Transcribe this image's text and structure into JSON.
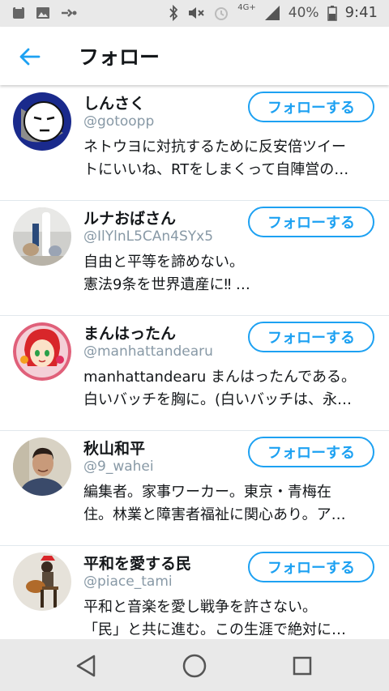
{
  "status_bar": {
    "network": "4G+",
    "battery_percent": "40%",
    "time": "9:41"
  },
  "header": {
    "title": "フォロー"
  },
  "users": [
    {
      "name": "しんさく",
      "handle": "@gotoopp",
      "bio_line1": "ネトウヨに対抗するために反安倍ツイー",
      "bio_line2": "トにいいね、RTをしまくって自陣営の…",
      "follow_label": "フォローする"
    },
    {
      "name": "ルナおばさん",
      "handle": "@IlYlnL5CAn4SYx5",
      "bio_line1": "自由と平等を諦めない。",
      "bio_line2": "憲法9条を世界遺産に‼ …",
      "follow_label": "フォローする"
    },
    {
      "name": "まんはったん",
      "handle": "@manhattandearu",
      "bio_line1": "manhattandearu まんはったんである。",
      "bio_line2": "白いバッチを胸に。(白いバッチは、永…",
      "follow_label": "フォローする"
    },
    {
      "name": "秋山和平",
      "handle": "@9_wahei",
      "bio_line1": "編集者。家事ワーカー。東京・青梅在",
      "bio_line2": "住。林業と障害者福祉に関心あり。ア…",
      "follow_label": "フォローする"
    },
    {
      "name": "平和を愛する民",
      "handle": "@piace_tami",
      "bio_line1": "平和と音楽を愛し戦争を許さない。",
      "bio_line2": "「民」と共に進む。この生涯で絶対に…",
      "follow_label": "フォローする"
    }
  ],
  "colors": {
    "accent": "#1da1f2",
    "text_primary": "#14171a",
    "text_secondary": "#8899a6"
  }
}
